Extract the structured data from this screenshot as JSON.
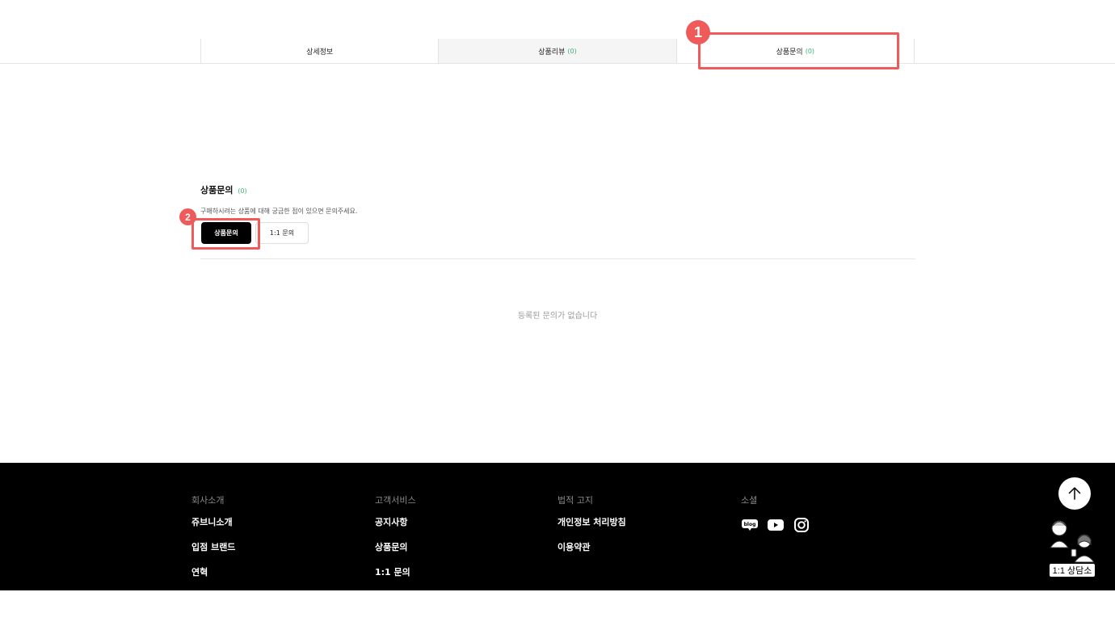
{
  "tabs": [
    {
      "label": "상세정보",
      "count": ""
    },
    {
      "label": "상품리뷰",
      "count": "(0)"
    },
    {
      "label": "상품문의",
      "count": "(0)"
    }
  ],
  "annotations": {
    "one": "1",
    "two": "2",
    "color": "#ef5a5a"
  },
  "qa": {
    "title": "상품문의",
    "count": "(0)",
    "description": "구매하시려는 상품에 대해 궁금한 점이 있으면 문의주세요.",
    "inquiry_button": "상품문의",
    "one_to_one_button": "1:1 문의",
    "empty_message": "등록된 문의가 없습니다"
  },
  "footer": {
    "company": {
      "heading": "회사소개",
      "links": [
        "쥬브니소개",
        "입점 브랜드",
        "연혁"
      ]
    },
    "service": {
      "heading": "고객서비스",
      "links": [
        "공지사항",
        "상품문의",
        "1:1 문의"
      ]
    },
    "legal": {
      "heading": "법적 고지",
      "links": [
        "개인정보 처리방침",
        "이용약관"
      ]
    },
    "social": {
      "heading": "소셜",
      "icons": [
        "blog-icon",
        "youtube-icon",
        "instagram-icon"
      ],
      "blog_text": "blog"
    }
  },
  "floating": {
    "top_icon": "arrow-up-icon",
    "chat_label": "1:1 상담소"
  },
  "colors": {
    "accent_green": "#3cb371",
    "footer_bg": "#000000"
  }
}
